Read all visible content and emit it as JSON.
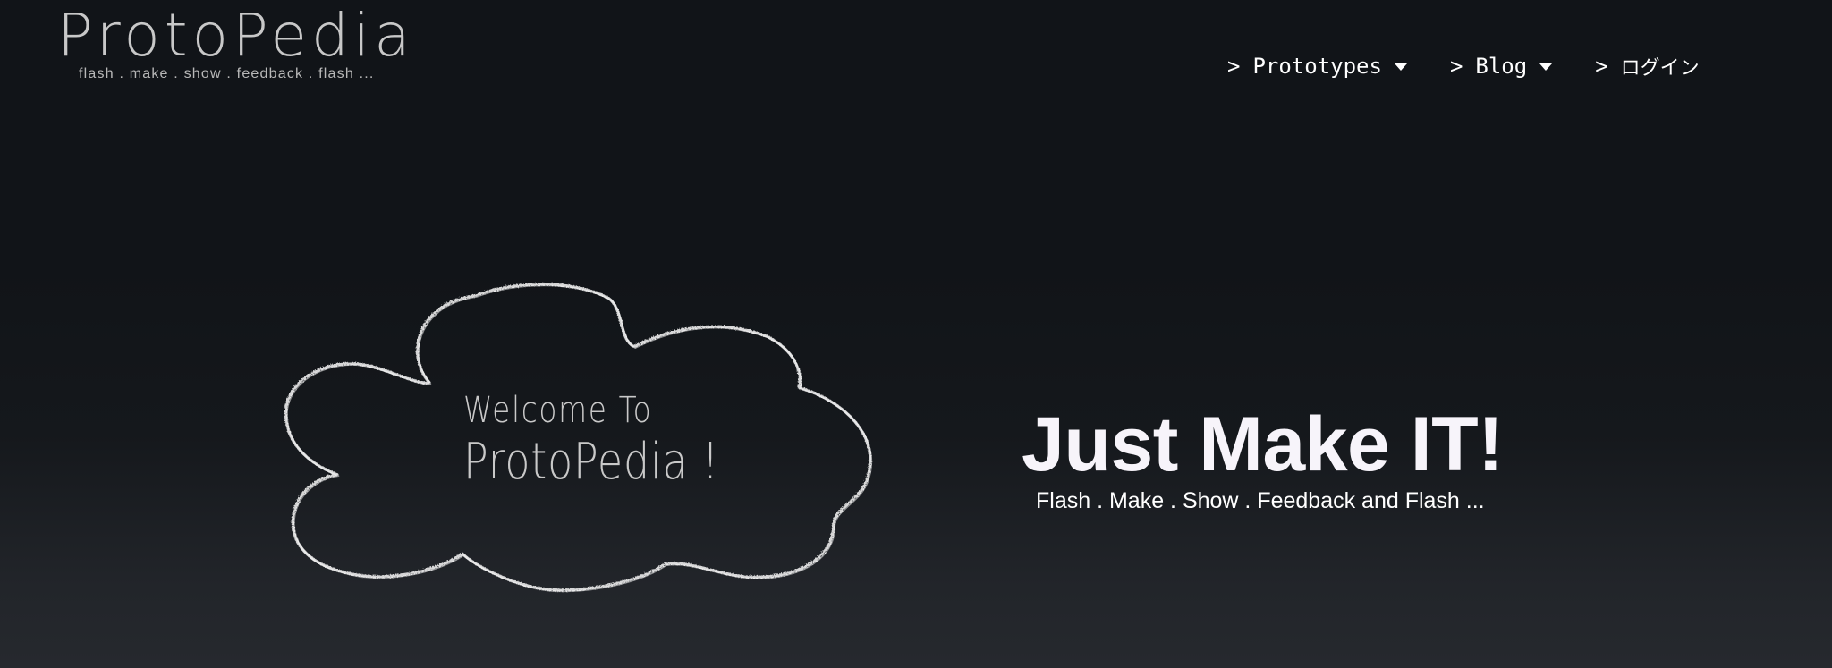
{
  "header": {
    "logo": {
      "title": "ProtoPedia",
      "tagline": "flash . make . show . feedback . flash ..."
    },
    "nav": [
      {
        "prefix": ">",
        "label": "Prototypes",
        "has_dropdown": true
      },
      {
        "prefix": ">",
        "label": "Blog",
        "has_dropdown": true
      },
      {
        "prefix": ">",
        "label": "ログイン",
        "has_dropdown": false
      }
    ]
  },
  "hero": {
    "cloud": {
      "line1": "Welcome To",
      "line2": "ProtoPedia !"
    },
    "title": "Just Make IT!",
    "subtitle": "Flash . Make . Show . Feedback and Flash ..."
  },
  "colors": {
    "background_top": "#111418",
    "background_bottom": "#26292e",
    "logo": "#c8c8c8",
    "hero_title": "#f7f4fa",
    "chalk": "#e6e6e6"
  }
}
